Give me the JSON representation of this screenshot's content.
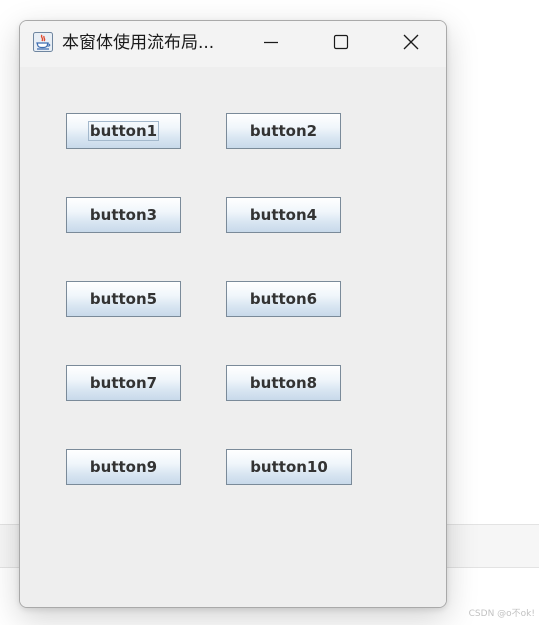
{
  "window": {
    "title": "本窗体使用流布局..."
  },
  "buttons": [
    "button1",
    "button2",
    "button3",
    "button4",
    "button5",
    "button6",
    "button7",
    "button8",
    "button9",
    "button10"
  ],
  "focused_button": "button1",
  "watermark": "CSDN @o不ok!",
  "colors": {
    "window_bg": "#eeeeee",
    "titlebar_bg": "#f3f3f3",
    "button_border": "#7a8a99",
    "button_text": "#333333"
  },
  "icons": {
    "app": "java-icon",
    "minimize": "minimize-icon",
    "maximize": "maximize-icon",
    "close": "close-icon"
  }
}
